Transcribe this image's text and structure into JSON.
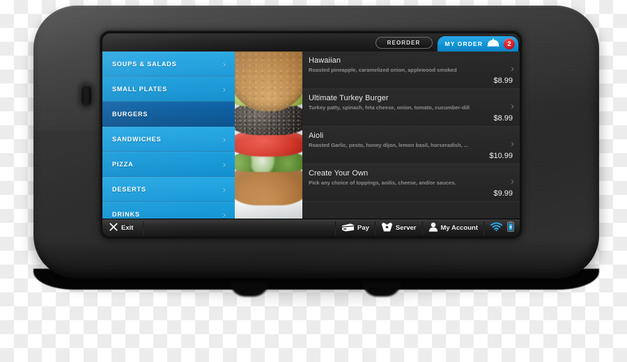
{
  "device": {
    "type": "tablet-kiosk",
    "shell_color": "#2f2f2f",
    "side_button_name": "power-button"
  },
  "colors": {
    "accent_blue": "#1fa0de",
    "active_blue": "#0e63a8",
    "badge_red": "#c1121f",
    "screen_dark": "#262626",
    "status_blue": "#29a3e0"
  },
  "header": {
    "reorder_label": "REORDER",
    "my_order_label": "MY ORDER",
    "my_order_icon": "food-dome-icon",
    "order_count": "2"
  },
  "sidebar": {
    "items": [
      {
        "label": "SOUPS & SALADS",
        "active": false
      },
      {
        "label": "SMALL PLATES",
        "active": false
      },
      {
        "label": "BURGERS",
        "active": true
      },
      {
        "label": "SANDWICHES",
        "active": false
      },
      {
        "label": "PIZZA",
        "active": false
      },
      {
        "label": "DESERTS",
        "active": false
      },
      {
        "label": "DRINKS",
        "active": false
      }
    ],
    "chevron_icon": "chevron-right-icon"
  },
  "photo": {
    "alt_name": "burger-photo",
    "subject": "close-up of a burger with tomato, lettuce and avocado on a white plate"
  },
  "menu": {
    "items": [
      {
        "name": "Hawaiian",
        "description": "Roasted pineapple, caramelized onion, applewood smoked",
        "price": "$8.99"
      },
      {
        "name": "Ultimate Turkey Burger",
        "description": "Turkey patty, spinach, feta cheese, onion, tomato, cucumber-dill",
        "price": "$8.99"
      },
      {
        "name": "Aioli",
        "description": "Roasted Garlic, pesto, honey dijon, lemon basil, horseradish, ...",
        "price": "$10.99"
      },
      {
        "name": "Create Your Own",
        "description": "Pick any choice of toppings, aoilis, cheese, and/or sauces.",
        "price": "$9.99"
      }
    ],
    "chevron_icon": "chevron-right-icon"
  },
  "toolbar": {
    "exit_label": "Exit",
    "exit_icon": "close-x-icon",
    "items": [
      {
        "label": "Pay",
        "icon": "credit-card-icon"
      },
      {
        "label": "Server",
        "icon": "bowtie-vest-icon"
      },
      {
        "label": "My Account",
        "icon": "person-icon"
      }
    ],
    "status": [
      {
        "icon": "wifi-icon"
      },
      {
        "icon": "battery-charging-icon"
      }
    ]
  }
}
